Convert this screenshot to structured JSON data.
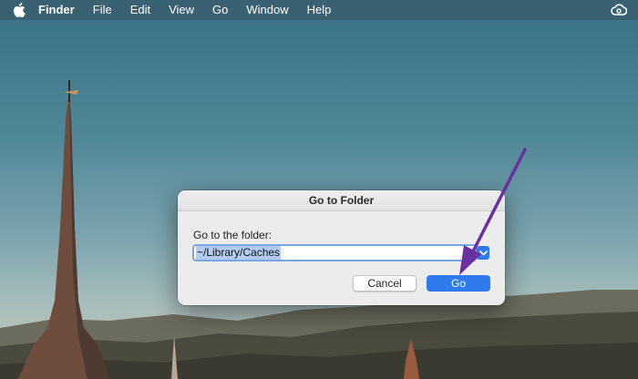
{
  "menubar": {
    "app_name": "Finder",
    "items": [
      "File",
      "Edit",
      "View",
      "Go",
      "Window",
      "Help"
    ],
    "apple_icon": "apple-icon",
    "status_icon": "creative-cloud-icon"
  },
  "dialog": {
    "title": "Go to Folder",
    "prompt": "Go to the folder:",
    "path_value": "~/Library/Caches",
    "cancel_label": "Cancel",
    "go_label": "Go"
  },
  "colors": {
    "accent": "#2f7bed",
    "annotation_arrow": "#6a2fa0"
  }
}
